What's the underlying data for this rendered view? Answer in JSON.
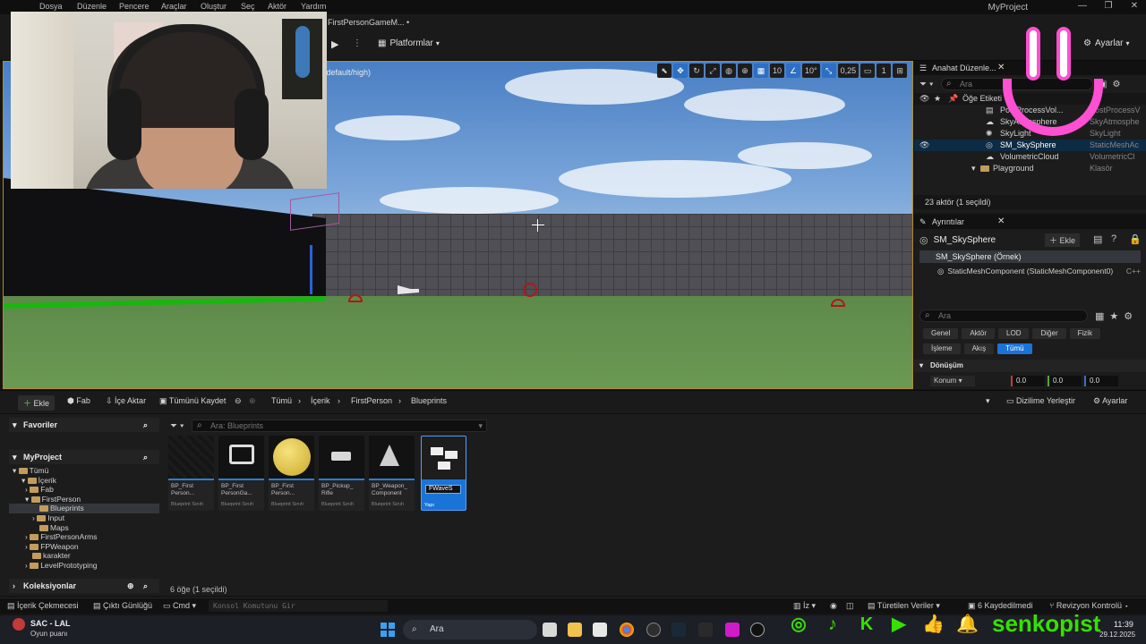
{
  "menu": [
    "Dosya",
    "Düzenle",
    "Pencere",
    "Araçlar",
    "Oluştur",
    "Seç",
    "Aktör",
    "Yardım"
  ],
  "window": {
    "title": "MyProject",
    "level_tab": "FirstPersonGameM... •"
  },
  "toolbar": {
    "platforms": "Platformlar",
    "settings": "Ayarlar"
  },
  "viewport": {
    "overlay_text": "/default/high)",
    "grid_snap": "10",
    "rotation_snap": "10°",
    "scale_snap": "0,25",
    "camera_speed": "1"
  },
  "outliner": {
    "tab": "Anahat Düzenle...",
    "search_placeholder": "Ara",
    "header": "Öğe Etiketi",
    "rows": [
      {
        "name": "PostProcessVol...",
        "type": "PostProcessV"
      },
      {
        "name": "SkyAtmosphere",
        "type": "SkyAtmosphe"
      },
      {
        "name": "SkyLight",
        "type": "SkyLight"
      },
      {
        "name": "SM_SkySphere",
        "type": "StaticMeshAc"
      },
      {
        "name": "VolumetricCloud",
        "type": "VolumetricCl"
      },
      {
        "name": "Playground",
        "type": "Klasör"
      }
    ],
    "status": "23 aktör (1 seçildi)"
  },
  "details": {
    "tab": "Ayrıntılar",
    "actor_name": "SM_SkySphere",
    "add_label": "Ekle",
    "instance": "SM_SkySphere (Örnek)",
    "component": "StaticMeshComponent (StaticMeshComponent0)",
    "component_suffix": "C++",
    "search_placeholder": "Ara",
    "categories": [
      "Genel",
      "Aktör",
      "LOD",
      "Diğer",
      "Fizik",
      "İşleme",
      "Akış",
      "Tümü"
    ],
    "section": "Dönüşüm",
    "location_label": "Konum",
    "location": [
      "0.0",
      "0.0",
      "0.0"
    ]
  },
  "content_browser": {
    "add": "Ekle",
    "fab": "Fab",
    "import": "İçe Aktar",
    "save_all": "Tümünü Kaydet",
    "crumbs": [
      "Tümü",
      "İçerik",
      "FirstPerson",
      "Blueprints"
    ],
    "dock": "Dizilime Yerleştir",
    "settings": "Ayarlar",
    "favorites": "Favoriler",
    "project": "MyProject",
    "collections": "Koleksiyonlar",
    "search_placeholder": "Ara: Blueprints",
    "folders": [
      "Tümü",
      "İçerik",
      "Fab",
      "FirstPerson",
      "Blueprints",
      "Input",
      "Maps",
      "FirstPersonArms",
      "FPWeapon",
      "karakter",
      "LevelPrototyping"
    ],
    "assets": [
      {
        "name": "BP_First Person...",
        "type": "Blueprint Sınıfı"
      },
      {
        "name": "BP_First PersonGa...",
        "type": "Blueprint Sınıfı"
      },
      {
        "name": "BP_First Person...",
        "type": "Blueprint Sınıfı"
      },
      {
        "name": "BP_Pickup_ Rifle",
        "type": "Blueprint Sınıfı"
      },
      {
        "name": "BP_Weapon_ Component",
        "type": "Blueprint Sınıfı"
      },
      {
        "name": "FWaveS",
        "type": "Yapı"
      }
    ],
    "status": "6 öğe (1 seçildi)"
  },
  "statusbar": {
    "drawer": "İçerik Çekmecesi",
    "output": "Çıktı Günlüğü",
    "cmd": "Cmd",
    "console_placeholder": "Konsol Komutunu Gir",
    "trace": "İz",
    "derived": "Türetilen Veriler",
    "saved": "6 Kaydedilmedi",
    "revision": "Revizyon Kontrolü"
  },
  "taskbar": {
    "weather_title": "SAC - LAL",
    "weather_sub": "Oyun puanı",
    "search": "Ara",
    "time": "11:39",
    "date": "29.12.2025"
  },
  "overlay": {
    "channel": "senkopist"
  }
}
